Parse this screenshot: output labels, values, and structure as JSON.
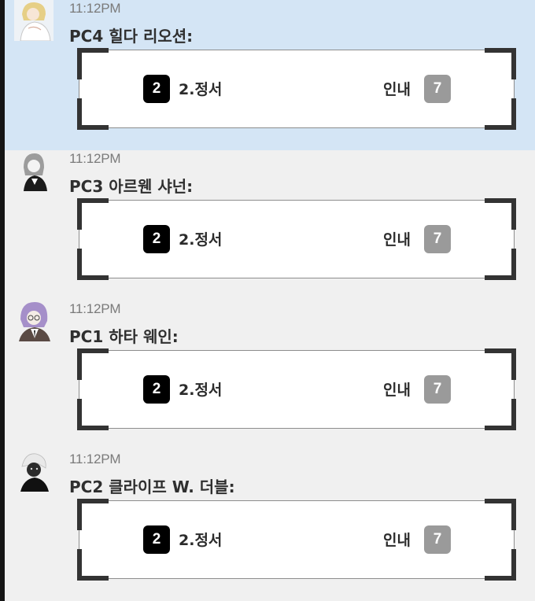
{
  "messages": [
    {
      "time": "11:12PM",
      "speaker": "PC4 힐다 리오션:",
      "highlighted": true,
      "avatar": "avatar-blonde-character",
      "roll": {
        "left_die": "2",
        "left_label": "2.정서",
        "right_label": "인내",
        "right_die": "7"
      }
    },
    {
      "time": "11:12PM",
      "speaker": "PC3 아르웬 샤넌:",
      "highlighted": false,
      "avatar": "avatar-gray-hair-character",
      "roll": {
        "left_die": "2",
        "left_label": "2.정서",
        "right_label": "인내",
        "right_die": "7"
      }
    },
    {
      "time": "11:12PM",
      "speaker": "PC1 하타 웨인:",
      "highlighted": false,
      "avatar": "avatar-purple-hair-glasses-character",
      "roll": {
        "left_die": "2",
        "left_label": "2.정서",
        "right_label": "인내",
        "right_die": "7"
      }
    },
    {
      "time": "11:12PM",
      "speaker": "PC2 클라이프 W. 더블:",
      "highlighted": false,
      "avatar": "avatar-white-hair-dark-character",
      "roll": {
        "left_die": "2",
        "left_label": "2.정서",
        "right_label": "인내",
        "right_die": "7"
      }
    }
  ],
  "colors": {
    "highlight_bg": "#d4e5f5",
    "default_bg": "#f0f0f0",
    "die_black": "#000000",
    "die_gray": "#9a9a9a"
  }
}
